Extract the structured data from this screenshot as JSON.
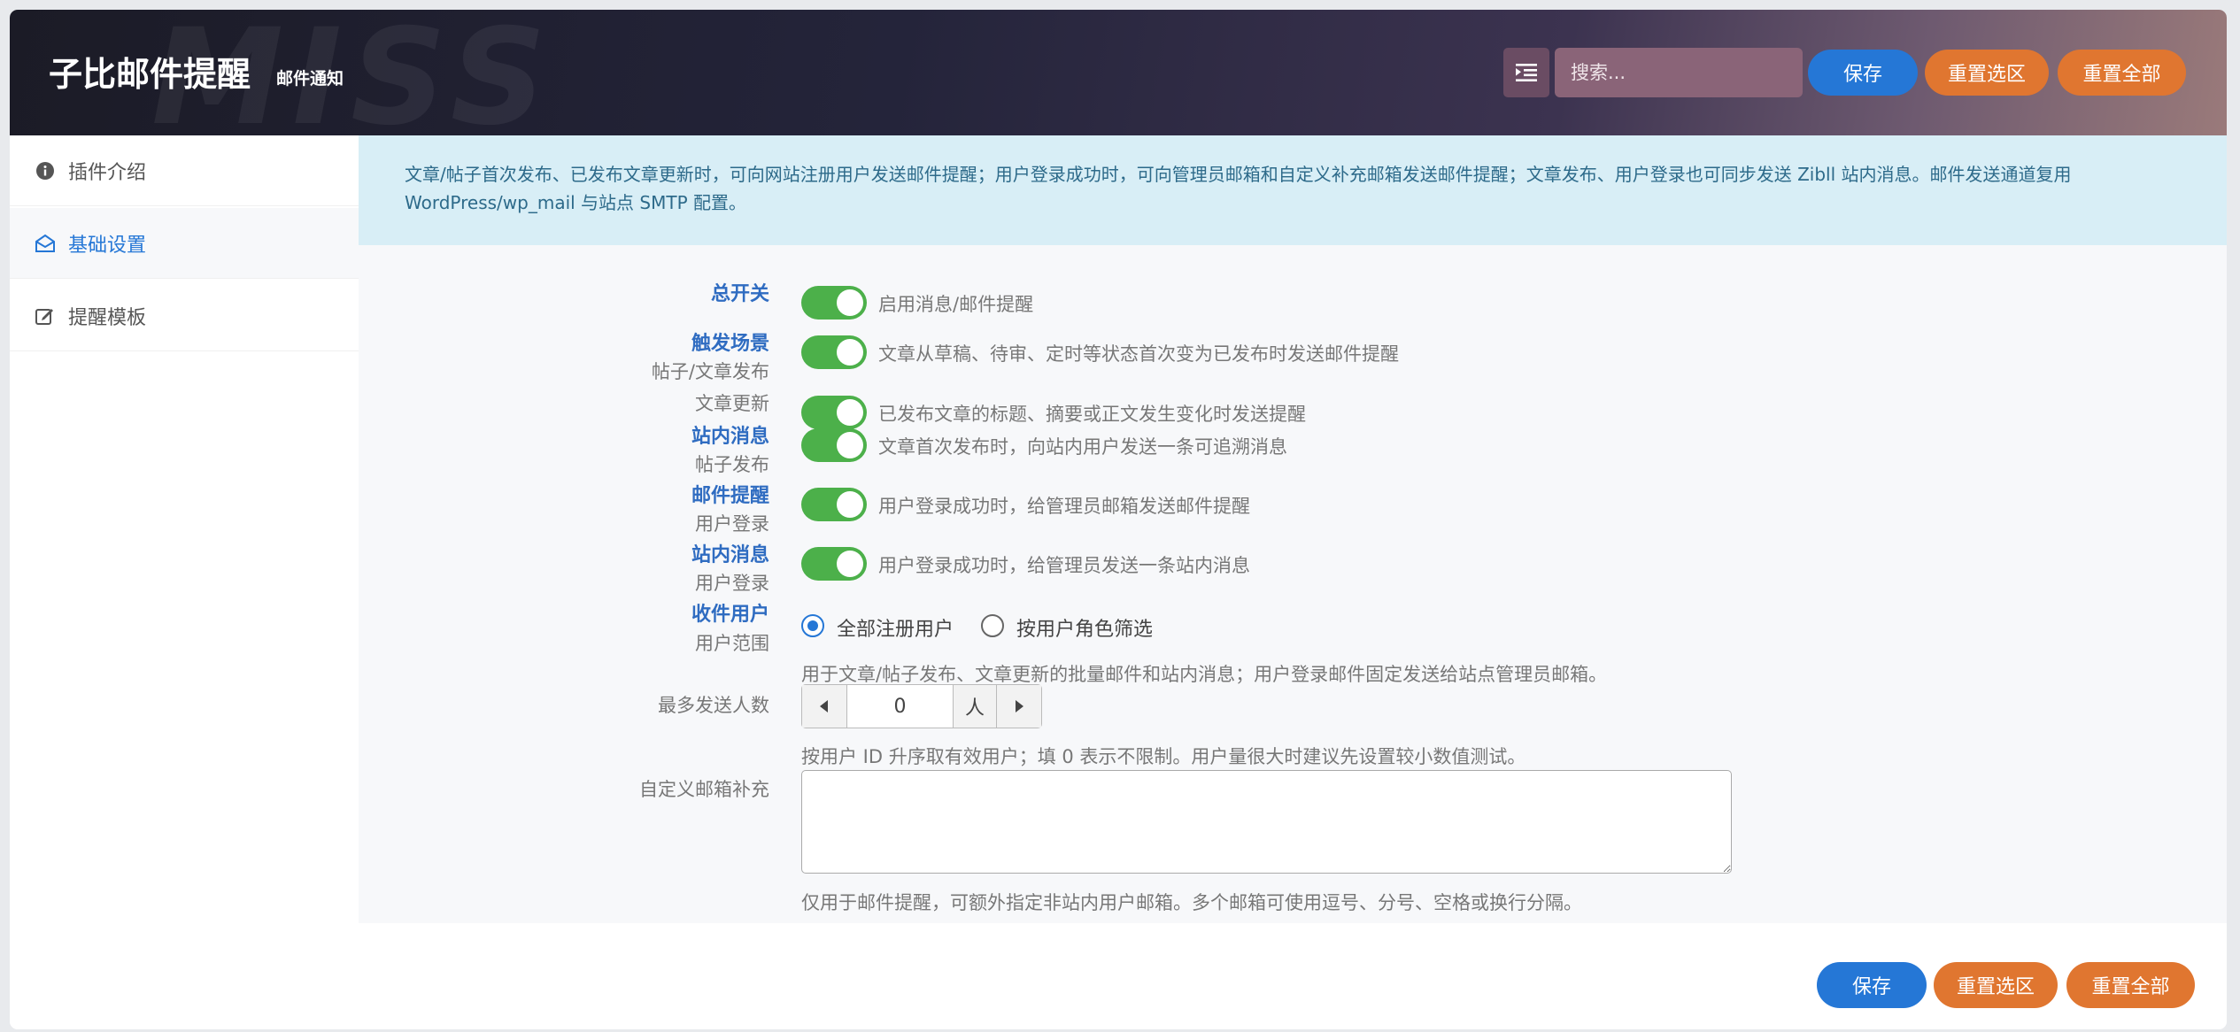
{
  "header": {
    "title": "子比邮件提醒",
    "subtitle": "邮件通知",
    "bg_word": "MISS",
    "search_placeholder": "搜索...",
    "save_label": "保存",
    "reset_section_label": "重置选区",
    "reset_all_label": "重置全部"
  },
  "sidebar": {
    "items": [
      {
        "label": "插件介绍",
        "icon": "info-circle-icon"
      },
      {
        "label": "基础设置",
        "icon": "envelope-open-icon",
        "active": true
      },
      {
        "label": "提醒模板",
        "icon": "edit-icon"
      }
    ]
  },
  "notice": "文章/帖子首次发布、已发布文章更新时，可向网站注册用户发送邮件提醒；用户登录成功时，可向管理员邮箱和自定义补充邮箱发送邮件提醒；文章发布、用户登录也可同步发送 Zibll 站内消息。邮件发送通道复用 WordPress/wp_mail 与站点 SMTP 配置。",
  "settings": {
    "master_label": "总开关",
    "master_desc": "启用消息/邮件提醒",
    "trigger_label": "触发场景",
    "trigger_sub": "帖子/文章发布",
    "trigger_desc": "文章从草稿、待审、定时等状态首次变为已发布时发送邮件提醒",
    "update_sub": "文章更新",
    "update_desc": "已发布文章的标题、摘要或正文发生变化时发送提醒",
    "site_msg_label": "站内消息",
    "site_msg_sub": "帖子发布",
    "site_msg_desc": "文章首次发布时，向站内用户发送一条可追溯消息",
    "mail_remind_label": "邮件提醒",
    "mail_remind_sub": "用户登录",
    "mail_remind_desc": "用户登录成功时，给管理员邮箱发送邮件提醒",
    "login_msg_label": "站内消息",
    "login_msg_sub": "用户登录",
    "login_msg_desc": "用户登录成功时，给管理员发送一条站内消息",
    "recipients_label": "收件用户",
    "recipients_sub": "用户范围",
    "recipients_options": [
      "全部注册用户",
      "按用户角色筛选"
    ],
    "recipients_selected": "全部注册用户",
    "recipients_desc": "用于文章/帖子发布、文章更新的批量邮件和站内消息；用户登录邮件固定发送给站点管理员邮箱。",
    "max_send_label": "最多发送人数",
    "max_send_value": "0",
    "max_send_unit": "人",
    "max_send_desc": "按用户 ID 升序取有效用户；填 0 表示不限制。用户量很大时建议先设置较小数值测试。",
    "custom_email_label": "自定义邮箱补充",
    "custom_email_value": "",
    "custom_email_desc": "仅用于邮件提醒，可额外指定非站内用户邮箱。多个邮箱可使用逗号、分号、空格或换行分隔。"
  },
  "footer": {
    "save_label": "保存",
    "reset_section_label": "重置选区",
    "reset_all_label": "重置全部"
  },
  "colors": {
    "primary": "#2577d6",
    "accent": "#e07630",
    "toggle_on": "#4cb04a",
    "label_blue": "#2f6cc1",
    "notice_bg": "#d8eef6"
  }
}
